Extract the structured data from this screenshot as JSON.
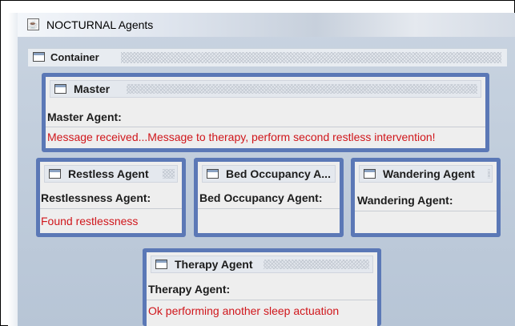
{
  "window": {
    "title": "NOCTURNAL Agents"
  },
  "container": {
    "title": "Container"
  },
  "master": {
    "title": "Master",
    "label": "Master Agent:",
    "message": "Message received...Message to therapy,  perform second restless intervention!"
  },
  "restless": {
    "title": "Restless Agent",
    "label": "Restlessness Agent:",
    "message": "Found restlessness"
  },
  "bed": {
    "title": "Bed Occupancy A...",
    "label": "Bed Occupancy Agent:",
    "message": ""
  },
  "wandering": {
    "title": "Wandering Agent",
    "label": "Wandering Agent:",
    "message": ""
  },
  "therapy": {
    "title": "Therapy Agent",
    "label": "Therapy Agent:",
    "message": "Ok performing another sleep actuation"
  },
  "colors": {
    "frame_border": "#5b78b6",
    "message": "#d0161b"
  },
  "icons": {
    "app": "java-cup-icon",
    "frame": "internal-frame-icon"
  }
}
